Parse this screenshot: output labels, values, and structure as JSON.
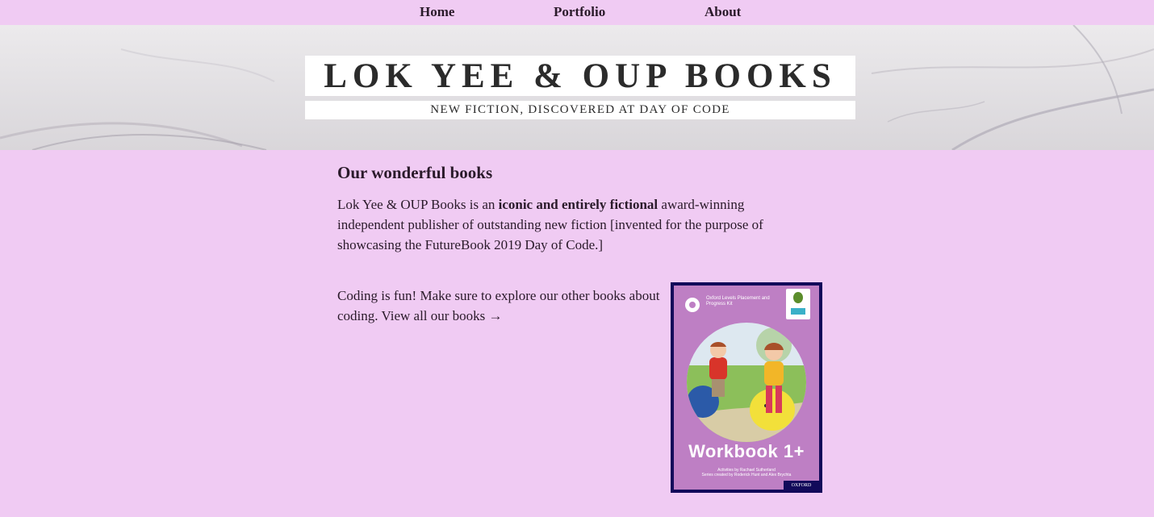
{
  "nav": {
    "home": "Home",
    "portfolio": "Portfolio",
    "about": "About"
  },
  "hero": {
    "title": "LOK YEE & OUP BOOKS",
    "subtitle": "NEW FICTION, DISCOVERED AT DAY OF CODE"
  },
  "main": {
    "heading": "Our wonderful books",
    "intro_before": "Lok Yee & OUP Books is an ",
    "intro_bold": "iconic and entirely fictional",
    "intro_after": " award-winning independent publisher of outstanding new fiction [invented for the purpose of showcasing the FutureBook 2019 Day of Code.]",
    "coding_text": "Coding is fun! Make sure to explore our other books about coding. ",
    "view_all_link": "View all our books →"
  },
  "cover": {
    "series_line": "Oxford Levels Placement and Progress Kit",
    "badge": "Oxford Reading Tree",
    "title": "Workbook 1+",
    "credits_1": "Activities by Rachael Sutherland",
    "credits_2": "Series created by Roderick Hunt and Alex Brychta",
    "publisher": "OXFORD"
  },
  "colors": {
    "background": "#f0cbf3",
    "text": "#2a1a2a",
    "cover_border": "#120a5a",
    "cover_fill": "#be7fc4"
  }
}
